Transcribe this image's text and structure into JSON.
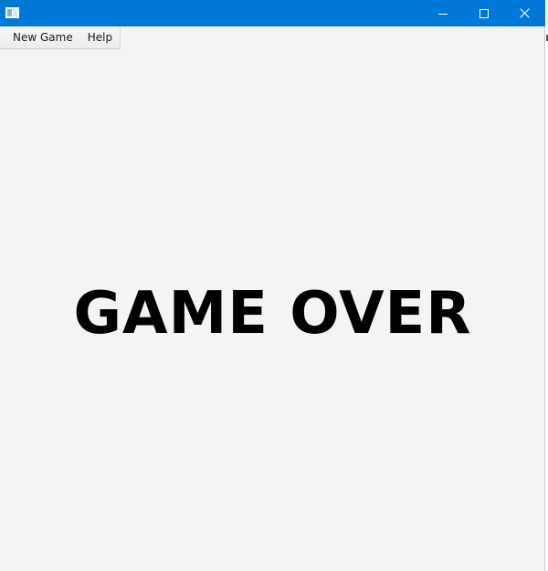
{
  "window": {
    "title": "",
    "titlebar_color": "#0078d7",
    "background_color": "#f4f4f4",
    "controls": {
      "minimize_icon": "minimize-icon",
      "maximize_icon": "maximize-icon",
      "close_icon": "close-icon"
    }
  },
  "menubar": {
    "items": [
      {
        "label": "New Game"
      },
      {
        "label": "Help"
      }
    ]
  },
  "main": {
    "message": "GAME OVER"
  }
}
